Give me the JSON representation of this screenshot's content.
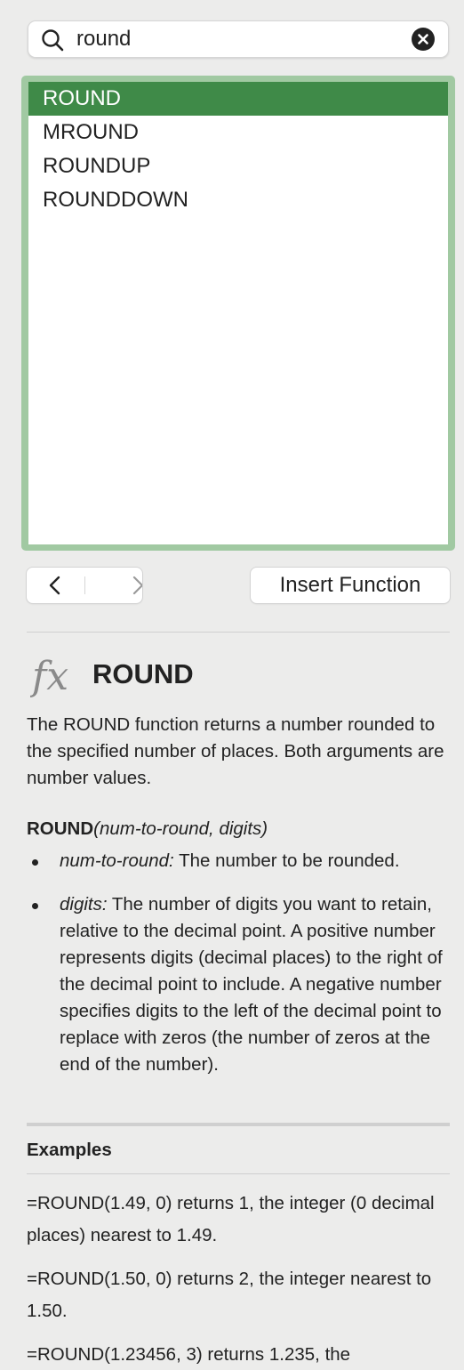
{
  "search": {
    "value": "round",
    "icon": "search-icon",
    "clear_icon": "clear-icon"
  },
  "results": {
    "selected": "ROUND",
    "items": [
      "ROUND",
      "MROUND",
      "ROUNDUP",
      "ROUNDDOWN"
    ]
  },
  "nav": {
    "back_icon": "chevron-left-icon",
    "forward_icon": "chevron-right-icon"
  },
  "insert_label": "Insert Function",
  "function": {
    "icon": "fx-icon",
    "name": "ROUND",
    "description": "The ROUND function returns a number rounded to the specified number of places. Both arguments are number values.",
    "syntax_name": "ROUND",
    "syntax_args": "(num-to-round, digits)",
    "arguments": [
      {
        "name": "num-to-round:",
        "text": " The number to be rounded."
      },
      {
        "name": "digits:",
        "text": " The number of digits you want to retain, relative to the decimal point. A positive number represents digits (decimal places) to the right of the decimal point to include. A negative number specifies digits to the left of the decimal point to replace with zeros (the number of zeros at the end of the number)."
      }
    ]
  },
  "examples": {
    "title": "Examples",
    "items": [
      "=ROUND(1.49, 0) returns 1, the integer (0 decimal places) nearest to 1.49.",
      "=ROUND(1.50, 0) returns 2, the integer nearest to 1.50.",
      "=ROUND(1.23456, 3) returns 1.235, the"
    ]
  },
  "colors": {
    "background": "#ececeb",
    "selection": "#3f8a48",
    "list_frame": "#a1c9a2"
  }
}
